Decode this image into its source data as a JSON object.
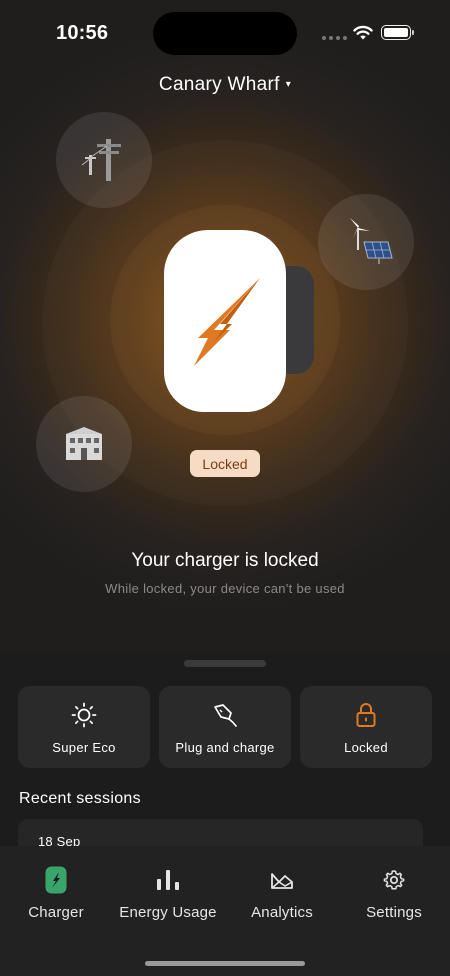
{
  "status_bar": {
    "time": "10:56"
  },
  "location": {
    "name": "Canary Wharf",
    "caret": "▾"
  },
  "energy_sources": [
    {
      "name": "grid-pylon-icon"
    },
    {
      "name": "solar-wind-icon"
    },
    {
      "name": "house-icon"
    }
  ],
  "charger": {
    "status_badge": "Locked",
    "title": "Your charger is locked",
    "subtitle": "While locked, your device can't be used",
    "accent": "#e07a22"
  },
  "actions": [
    {
      "label": "Super Eco",
      "icon": "sun-icon"
    },
    {
      "label": "Plug and charge",
      "icon": "plug-icon"
    },
    {
      "label": "Locked",
      "icon": "lock-icon"
    }
  ],
  "recent_sessions": {
    "title": "Recent sessions",
    "items": [
      {
        "date": "18 Sep"
      }
    ]
  },
  "tabs": [
    {
      "label": "Charger",
      "icon": "charger-icon",
      "active": true
    },
    {
      "label": "Energy Usage",
      "icon": "bar-chart-icon"
    },
    {
      "label": "Analytics",
      "icon": "analytics-icon"
    },
    {
      "label": "Settings",
      "icon": "gear-icon"
    }
  ],
  "colors": {
    "accent": "#e07a22",
    "active_tab": "#3aa56b",
    "background": "#1a1a1a"
  }
}
